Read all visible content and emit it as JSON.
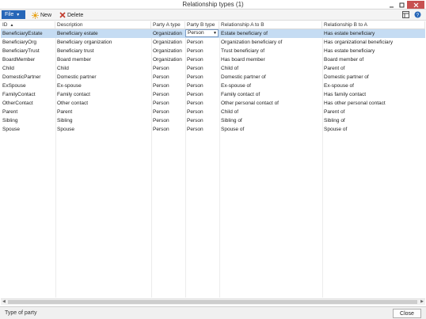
{
  "window": {
    "title": "Relationship types (1)"
  },
  "toolbar": {
    "file_label": "File",
    "new_label": "New",
    "delete_label": "Delete"
  },
  "grid": {
    "columns": [
      {
        "key": "id",
        "label": "ID",
        "sorted": true
      },
      {
        "key": "description",
        "label": "Description"
      },
      {
        "key": "party_a",
        "label": "Party A type"
      },
      {
        "key": "party_b",
        "label": "Party B type"
      },
      {
        "key": "a_to_b",
        "label": "Relationship A to B"
      },
      {
        "key": "b_to_a",
        "label": "Relationship B to A"
      }
    ],
    "rows": [
      {
        "id": "BeneficiaryEstate",
        "description": "Beneficiary estate",
        "party_a": "Organization",
        "party_b": "Person",
        "a_to_b": "Estate beneficiary of",
        "b_to_a": "Has estate beneficiary",
        "selected": true
      },
      {
        "id": "BeneficiaryOrg",
        "description": "Beneficiary organization",
        "party_a": "Organization",
        "party_b": "Person",
        "a_to_b": "Organization beneficiary of",
        "b_to_a": "Has organizational beneficiary"
      },
      {
        "id": "BeneficiaryTrust",
        "description": "Beneficiary trust",
        "party_a": "Organization",
        "party_b": "Person",
        "a_to_b": "Trust beneficiary of",
        "b_to_a": "Has estate beneficiary"
      },
      {
        "id": "BoardMember",
        "description": "Board member",
        "party_a": "Organization",
        "party_b": "Person",
        "a_to_b": "Has board member",
        "b_to_a": "Board member of"
      },
      {
        "id": "Child",
        "description": "Child",
        "party_a": "Person",
        "party_b": "Person",
        "a_to_b": "Child of",
        "b_to_a": "Parent of"
      },
      {
        "id": "DomesticPartner",
        "description": "Domestic partner",
        "party_a": "Person",
        "party_b": "Person",
        "a_to_b": "Domestic partner of",
        "b_to_a": "Domestic partner of"
      },
      {
        "id": "ExSpouse",
        "description": "Ex-spouse",
        "party_a": "Person",
        "party_b": "Person",
        "a_to_b": "Ex-spouse of",
        "b_to_a": "Ex-spouse of"
      },
      {
        "id": "FamilyContact",
        "description": "Family contact",
        "party_a": "Person",
        "party_b": "Person",
        "a_to_b": "Family contact of",
        "b_to_a": "Has family contact"
      },
      {
        "id": "OtherContact",
        "description": "Other contact",
        "party_a": "Person",
        "party_b": "Person",
        "a_to_b": "Other personal contact of",
        "b_to_a": "Has other personal contact"
      },
      {
        "id": "Parent",
        "description": "Parent",
        "party_a": "Person",
        "party_b": "Person",
        "a_to_b": "Child of",
        "b_to_a": "Parent of"
      },
      {
        "id": "Sibling",
        "description": "Sibling",
        "party_a": "Person",
        "party_b": "Person",
        "a_to_b": "Sibling of",
        "b_to_a": "Sibling of"
      },
      {
        "id": "Spouse",
        "description": "Spouse",
        "party_a": "Person",
        "party_b": "Person",
        "a_to_b": "Spouse of",
        "b_to_a": "Spouse of"
      }
    ],
    "active_cell": {
      "column": "party_b",
      "value": "Person"
    }
  },
  "status": {
    "text": "Type of party",
    "close_label": "Close"
  },
  "colors": {
    "accent": "#2767b8",
    "selected_row": "#c5dcf3",
    "delete_icon": "#c0392b",
    "new_icon": "#e8a317"
  },
  "icons": {
    "new": "sun-star-icon",
    "delete": "red-x-icon",
    "minimize": "minimize-icon",
    "maximize": "maximize-icon",
    "close": "close-icon"
  }
}
